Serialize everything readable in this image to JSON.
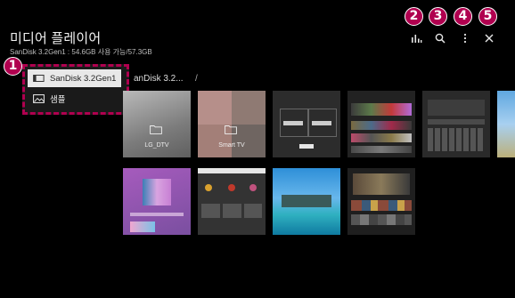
{
  "header": {
    "title": "미디어 플레이어",
    "storage_info": "SanDisk 3.2Gen1 : 54.6GB 사용 가능/57.3GB"
  },
  "toolbar": {
    "icons": [
      "equalizer-icon",
      "search-icon",
      "more-icon",
      "close-icon"
    ]
  },
  "callouts": [
    "1",
    "2",
    "3",
    "4",
    "5"
  ],
  "path": {
    "current": "anDisk 3.2...",
    "separator": "/"
  },
  "storage_menu": {
    "items": [
      {
        "label": "SanDisk 3.2Gen1",
        "icon": "usb-drive-icon",
        "selected": true
      },
      {
        "label": "샘플",
        "icon": "image-icon",
        "selected": false
      }
    ]
  },
  "grid": {
    "folders": [
      {
        "label": "LG_DTV"
      },
      {
        "label": "Smart TV"
      }
    ]
  },
  "colors": {
    "callout": "#b0004f",
    "menu_border": "#b0004f",
    "selected_bg": "#e8e8e8"
  }
}
